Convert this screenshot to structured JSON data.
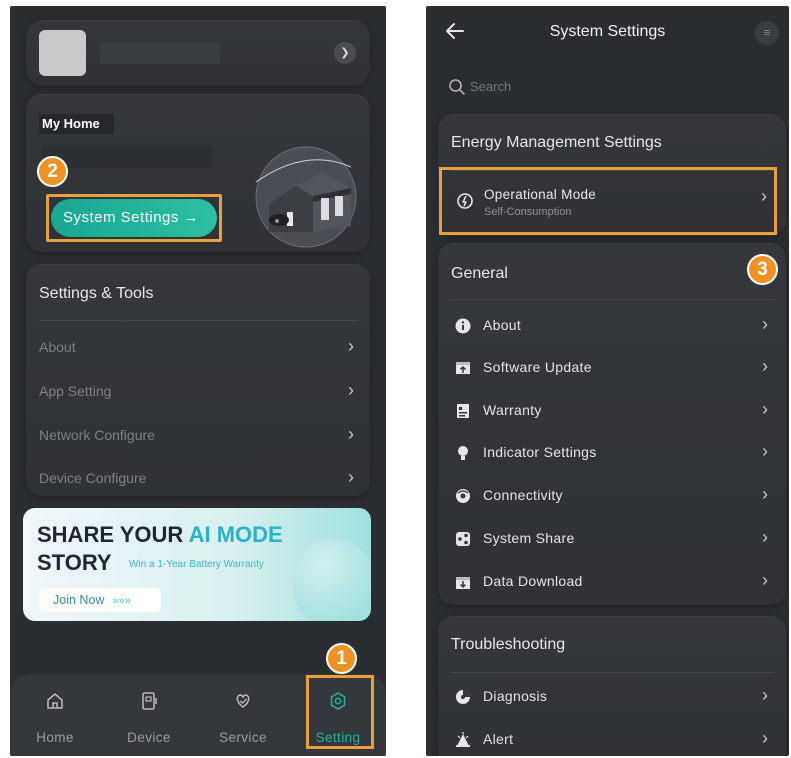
{
  "left_screen": {
    "home_card": {
      "label": "My Home",
      "system_settings_button": "System Settings →"
    },
    "settings_tools": {
      "title": "Settings & Tools",
      "items": [
        {
          "label": "About"
        },
        {
          "label": "App Setting"
        },
        {
          "label": "Network Configure"
        },
        {
          "label": "Device Configure"
        }
      ]
    },
    "banner": {
      "line1_a": "SHARE YOUR ",
      "line1_b": "AI MODE",
      "line2": "STORY",
      "tagline": "Win a 1-Year Battery Warranty",
      "cta": "Join Now",
      "cta_arrows": "»»»"
    },
    "tabs": [
      {
        "label": "Home",
        "icon": "home-icon"
      },
      {
        "label": "Device",
        "icon": "device-icon"
      },
      {
        "label": "Service",
        "icon": "service-icon"
      },
      {
        "label": "Setting",
        "icon": "gear-icon",
        "active": true
      }
    ]
  },
  "right_screen": {
    "title": "System Settings",
    "search_placeholder": "Search",
    "energy": {
      "title": "Energy Management Settings",
      "operational_mode": {
        "label": "Operational Mode",
        "value": "Self-Consumption"
      }
    },
    "general": {
      "title": "General",
      "items": [
        {
          "label": "About",
          "icon": "info-icon"
        },
        {
          "label": "Software Update",
          "icon": "update-icon"
        },
        {
          "label": "Warranty",
          "icon": "warranty-icon"
        },
        {
          "label": "Indicator Settings",
          "icon": "indicator-icon"
        },
        {
          "label": "Connectivity",
          "icon": "connectivity-icon"
        },
        {
          "label": "System Share",
          "icon": "share-icon"
        },
        {
          "label": "Data Download",
          "icon": "download-icon"
        }
      ]
    },
    "troubleshooting": {
      "title": "Troubleshooting",
      "items": [
        {
          "label": "Diagnosis",
          "icon": "diagnosis-icon"
        },
        {
          "label": "Alert",
          "icon": "alert-icon"
        }
      ]
    }
  },
  "step_badges": [
    "1",
    "2",
    "3"
  ],
  "colors": {
    "accent": "#21b29c",
    "highlight": "#e8a03a",
    "badge": "#ef9223",
    "background": "#2a2d31"
  }
}
